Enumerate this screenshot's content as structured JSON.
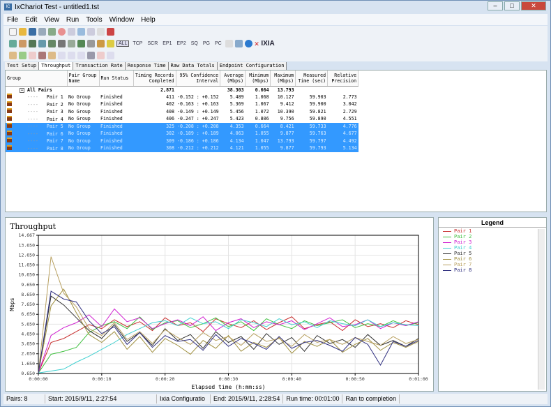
{
  "window": {
    "title": "IxChariot Test - untitled1.tst",
    "app_icon": "IC"
  },
  "menu": [
    "File",
    "Edit",
    "View",
    "Run",
    "Tools",
    "Window",
    "Help"
  ],
  "toolbar2_labels": [
    "ALL",
    "TCP",
    "SCR",
    "EP1",
    "EP2",
    "SQ",
    "PG",
    "PC"
  ],
  "brand": "IXIA",
  "tabs": [
    "Test Setup",
    "Throughput",
    "Transaction Rate",
    "Response Time",
    "Raw Data Totals",
    "Endpoint Configuration"
  ],
  "active_tab": "Throughput",
  "table": {
    "headers": [
      "Group",
      "Pair Group Name",
      "Run Status",
      "Timing Records Completed",
      "95% Confidence Interval",
      "Average (Mbps)",
      "Minimum (Mbps)",
      "Maximum (Mbps)",
      "Measured Time (sec)",
      "Relative Precision"
    ],
    "total": {
      "label": "All Pairs",
      "records": "2,871",
      "average": "38.303",
      "minimum": "0.664",
      "maximum": "13.793"
    },
    "rows": [
      {
        "pair": "Pair 1",
        "group": "No Group",
        "status": "Finished",
        "records": "411",
        "ci": "-0.152 : +0.152",
        "avg": "5.489",
        "min": "1.068",
        "max": "10.127",
        "time": "59.903",
        "prec": "2.773",
        "selected": false
      },
      {
        "pair": "Pair 2",
        "group": "No Group",
        "status": "Finished",
        "records": "402",
        "ci": "-0.163 : +0.163",
        "avg": "5.369",
        "min": "1.067",
        "max": "9.412",
        "time": "59.900",
        "prec": "3.042",
        "selected": false
      },
      {
        "pair": "Pair 3",
        "group": "No Group",
        "status": "Finished",
        "records": "408",
        "ci": "-0.149 : +0.149",
        "avg": "5.456",
        "min": "1.072",
        "max": "10.390",
        "time": "59.821",
        "prec": "2.729",
        "selected": false
      },
      {
        "pair": "Pair 4",
        "group": "No Group",
        "status": "Finished",
        "records": "406",
        "ci": "-0.247 : +0.247",
        "avg": "5.423",
        "min": "0.806",
        "max": "9.756",
        "time": "59.890",
        "prec": "4.551",
        "selected": false
      },
      {
        "pair": "Pair 5",
        "group": "No Group",
        "status": "Finished",
        "records": "325",
        "ci": "-0.208 : +0.208",
        "avg": "4.353",
        "min": "0.664",
        "max": "8.421",
        "time": "59.733",
        "prec": "4.776",
        "selected": true
      },
      {
        "pair": "Pair 6",
        "group": "No Group",
        "status": "Finished",
        "records": "302",
        "ci": "-0.189 : +0.189",
        "avg": "4.063",
        "min": "1.055",
        "max": "9.877",
        "time": "59.763",
        "prec": "4.677",
        "selected": true
      },
      {
        "pair": "Pair 7",
        "group": "No Group",
        "status": "Finished",
        "records": "309",
        "ci": "-0.186 : +0.186",
        "avg": "4.134",
        "min": "1.047",
        "max": "13.793",
        "time": "59.797",
        "prec": "4.492",
        "selected": true
      },
      {
        "pair": "Pair 8",
        "group": "No Group",
        "status": "Finished",
        "records": "308",
        "ci": "-0.212 : +0.212",
        "avg": "4.121",
        "min": "1.055",
        "max": "9.877",
        "time": "59.793",
        "prec": "5.134",
        "selected": true
      }
    ]
  },
  "legend_title": "Legend",
  "chart_data": {
    "type": "line",
    "title": "Throughput",
    "xlabel": "Elapsed time (h:mm:ss)",
    "ylabel": "Mbps",
    "ylim": [
      0.65,
      14.667
    ],
    "xlim": [
      0,
      60
    ],
    "grid": true,
    "legend": "right panel",
    "yticks": [
      "0.650",
      "1.650",
      "2.650",
      "3.650",
      "4.650",
      "5.650",
      "6.650",
      "7.650",
      "8.650",
      "9.650",
      "10.650",
      "11.650",
      "12.650",
      "13.650",
      "14.667"
    ],
    "xticks": [
      "0:00:00",
      "0:00:10",
      "0:00:20",
      "0:00:30",
      "0:00:40",
      "0:00:50",
      "0:01:00"
    ],
    "x": [
      0,
      2,
      4,
      6,
      8,
      10,
      12,
      14,
      16,
      18,
      20,
      22,
      24,
      26,
      28,
      30,
      32,
      34,
      36,
      38,
      40,
      42,
      44,
      46,
      48,
      50,
      52,
      54,
      56,
      58,
      60
    ],
    "series": [
      {
        "name": "Pair 1",
        "color": "#c83030",
        "values": [
          0.7,
          3.8,
          4.2,
          4.9,
          5.6,
          5.2,
          6.1,
          5.4,
          5.9,
          5.0,
          6.3,
          5.5,
          5.8,
          4.9,
          6.2,
          5.7,
          5.3,
          6.0,
          5.1,
          5.8,
          6.4,
          5.2,
          5.6,
          5.9,
          5.0,
          6.1,
          5.4,
          5.7,
          5.3,
          6.0,
          5.6
        ]
      },
      {
        "name": "Pair 2",
        "color": "#40c040",
        "values": [
          0.7,
          2.6,
          2.9,
          3.3,
          4.8,
          5.5,
          5.9,
          5.2,
          6.4,
          5.1,
          5.8,
          6.0,
          5.3,
          5.7,
          6.3,
          5.4,
          5.9,
          5.0,
          6.2,
          5.6,
          5.2,
          6.0,
          5.5,
          5.8,
          6.1,
          5.3,
          5.7,
          5.4,
          6.0,
          5.5,
          5.8
        ]
      },
      {
        "name": "Pair 3",
        "color": "#d020d0",
        "values": [
          0.7,
          4.5,
          5.3,
          5.8,
          6.6,
          5.4,
          7.2,
          5.9,
          6.3,
          5.2,
          5.7,
          6.1,
          5.5,
          6.4,
          5.0,
          5.8,
          6.2,
          5.3,
          5.9,
          5.6,
          6.0,
          5.1,
          5.7,
          6.3,
          5.4,
          5.6,
          6.1,
          5.2,
          5.8,
          5.5,
          5.9
        ]
      },
      {
        "name": "Pair 4",
        "color": "#40d0d0",
        "values": [
          0.7,
          0.9,
          1.1,
          1.8,
          2.4,
          3.1,
          3.8,
          4.6,
          5.2,
          5.8,
          6.0,
          5.5,
          6.3,
          5.7,
          5.9,
          5.2,
          6.1,
          5.8,
          5.4,
          6.2,
          5.6,
          5.9,
          5.3,
          6.0,
          5.7,
          5.5,
          6.1,
          5.4,
          5.8,
          5.6,
          5.5
        ]
      },
      {
        "name": "Pair 5",
        "color": "#303030",
        "values": [
          0.7,
          8.5,
          7.6,
          6.3,
          5.0,
          4.2,
          5.6,
          3.9,
          4.8,
          3.5,
          5.2,
          4.0,
          4.6,
          3.2,
          4.9,
          3.8,
          4.4,
          3.1,
          4.7,
          3.6,
          4.3,
          2.9,
          4.5,
          3.7,
          4.1,
          3.3,
          4.6,
          3.5,
          4.0,
          3.4,
          4.2
        ]
      },
      {
        "name": "Pair 6",
        "color": "#a09040",
        "values": [
          0.7,
          7.5,
          9.2,
          6.8,
          4.6,
          3.8,
          4.9,
          3.1,
          4.4,
          2.8,
          4.2,
          3.5,
          2.6,
          4.0,
          3.2,
          4.5,
          2.9,
          3.8,
          3.3,
          4.3,
          2.7,
          3.9,
          3.4,
          4.1,
          2.8,
          3.6,
          4.2,
          3.0,
          3.8,
          3.3,
          3.9
        ]
      },
      {
        "name": "Pair 7",
        "color": "#b8a060",
        "values": [
          0.7,
          12.5,
          8.8,
          7.4,
          5.2,
          4.5,
          5.8,
          4.1,
          4.9,
          3.7,
          5.1,
          4.3,
          3.6,
          4.8,
          4.0,
          4.4,
          3.5,
          4.7,
          3.9,
          4.2,
          3.4,
          4.6,
          3.8,
          4.1,
          3.6,
          4.3,
          3.9,
          3.5,
          4.4,
          3.7,
          4.1
        ]
      },
      {
        "name": "Pair 8",
        "color": "#303080",
        "values": [
          0.7,
          9.0,
          8.2,
          7.9,
          6.0,
          4.7,
          5.4,
          3.6,
          4.8,
          3.3,
          4.5,
          3.9,
          4.1,
          3.0,
          4.6,
          3.4,
          4.2,
          3.7,
          3.1,
          4.4,
          3.2,
          3.8,
          4.0,
          3.5,
          2.9,
          4.3,
          3.6,
          1.5,
          3.9,
          3.4,
          4.0
        ]
      }
    ]
  },
  "status": {
    "pairs": "Pairs: 8",
    "start": "Start: 2015/9/11, 2:27:54",
    "config": "Ixia Configuratio",
    "end": "End: 2015/9/11, 2:28:54",
    "runtime": "Run time: 00:01:00",
    "result": "Ran to completion"
  }
}
